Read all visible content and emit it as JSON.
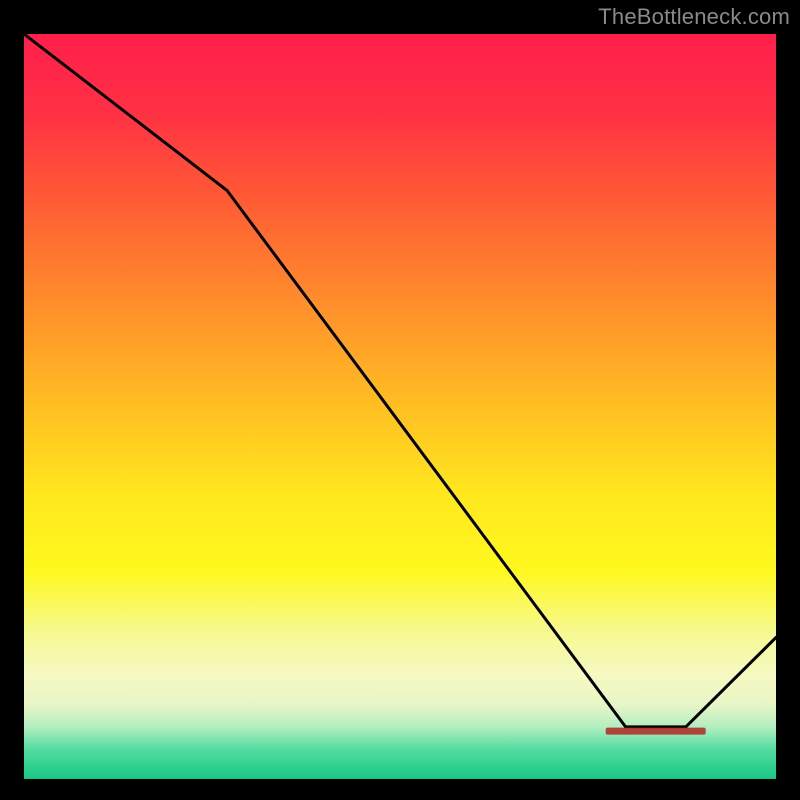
{
  "attribution": "TheBottleneck.com",
  "marker": {
    "label": "",
    "x_fraction": 0.84,
    "y_fraction": 0.935
  },
  "chart_data": {
    "type": "line",
    "title": "",
    "xlabel": "",
    "ylabel": "",
    "xlim": [
      0,
      1
    ],
    "ylim": [
      0,
      1
    ],
    "x": [
      0.0,
      0.27,
      0.8,
      0.88,
      1.0
    ],
    "y": [
      1.0,
      0.79,
      0.07,
      0.07,
      0.19
    ],
    "notes": "Axes and tick labels are not visible; x/y are normalized to plot extents. The line starts high at the left, descends, flattens near the bottom around x≈0.80–0.88, then rises toward x=1. Background is a vertical red→yellow→green gradient.",
    "gradient_stops": [
      {
        "pos": 0.0,
        "color": "#ff1f4b"
      },
      {
        "pos": 0.1,
        "color": "#ff2f45"
      },
      {
        "pos": 0.22,
        "color": "#ff5a35"
      },
      {
        "pos": 0.35,
        "color": "#ff8a2c"
      },
      {
        "pos": 0.5,
        "color": "#ffbf22"
      },
      {
        "pos": 0.62,
        "color": "#ffe81e"
      },
      {
        "pos": 0.72,
        "color": "#fff81e"
      },
      {
        "pos": 0.8,
        "color": "#f7f98d"
      },
      {
        "pos": 0.86,
        "color": "#f6f9c2"
      },
      {
        "pos": 0.9,
        "color": "#e8f6c6"
      },
      {
        "pos": 0.93,
        "color": "#b3eec0"
      },
      {
        "pos": 0.96,
        "color": "#53dca0"
      },
      {
        "pos": 1.0,
        "color": "#18c885"
      }
    ],
    "line_color": "#000000",
    "line_width": 3,
    "marker_color": "#b02822"
  }
}
